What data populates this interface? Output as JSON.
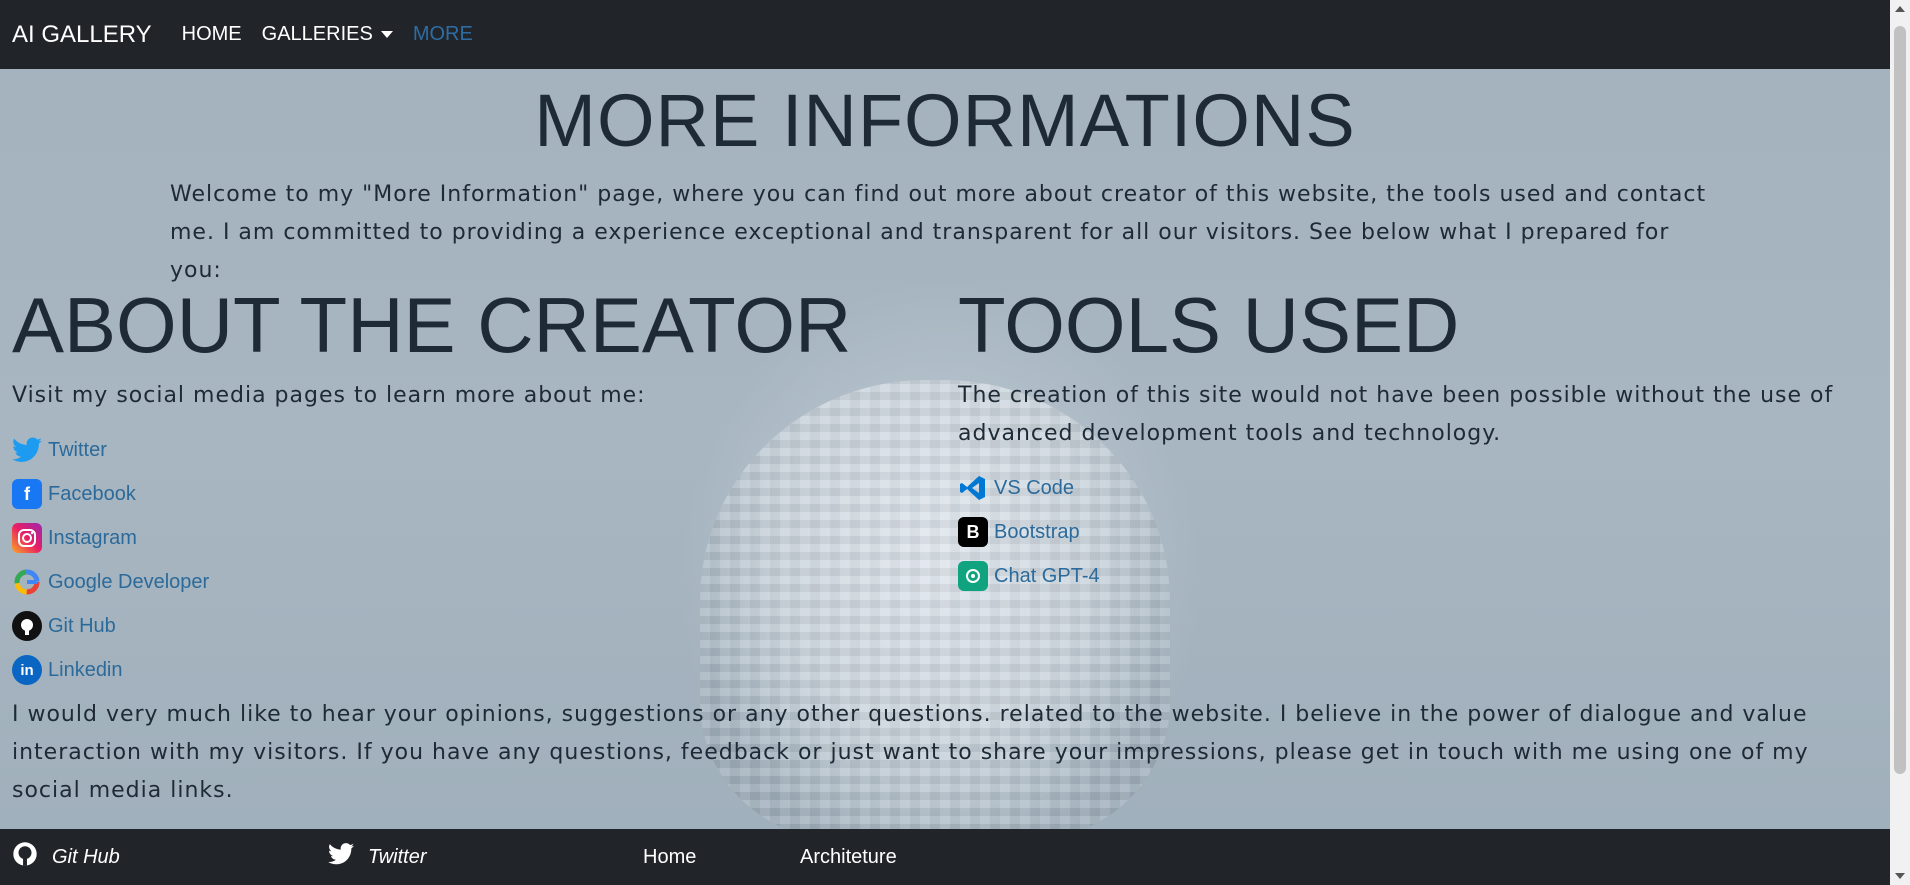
{
  "nav": {
    "brand": "AI GALLERY",
    "links": [
      "HOME",
      "GALLERIES",
      "MORE"
    ]
  },
  "page": {
    "title": "MORE INFORMATIONS",
    "intro": "Welcome to my \"More Information\" page, where you can find out more about creator of this website, the tools used and contact me. I am committed to providing a experience exceptional and transparent for all our visitors. See below what I prepared for you:"
  },
  "about": {
    "heading": "ABOUT THE CREATOR",
    "text": "Visit my social media pages to learn more about me:",
    "links": [
      "Twitter",
      "Facebook",
      "Instagram",
      "Google Developer",
      "Git Hub",
      "Linkedin"
    ]
  },
  "tools": {
    "heading": "TOOLS USED",
    "text": "The creation of this site would not have been possible without the use of advanced development tools and technology.",
    "links": [
      "VS Code",
      "Bootstrap",
      "Chat GPT-4"
    ]
  },
  "closing": "I would very much like to hear your opinions, suggestions or any other questions. related to the website. I believe in the power of dialogue and value interaction with my visitors. If you have any questions, feedback or just want to share your impressions, please get in touch with me using one of my social media links.",
  "footer": {
    "items": [
      "Git Hub",
      "Twitter",
      "Home",
      "Architeture"
    ]
  },
  "colors": {
    "navbar": "#212529",
    "link": "#2b6a9a",
    "active_nav": "#2e6da4",
    "background": "#a3b2bd"
  }
}
